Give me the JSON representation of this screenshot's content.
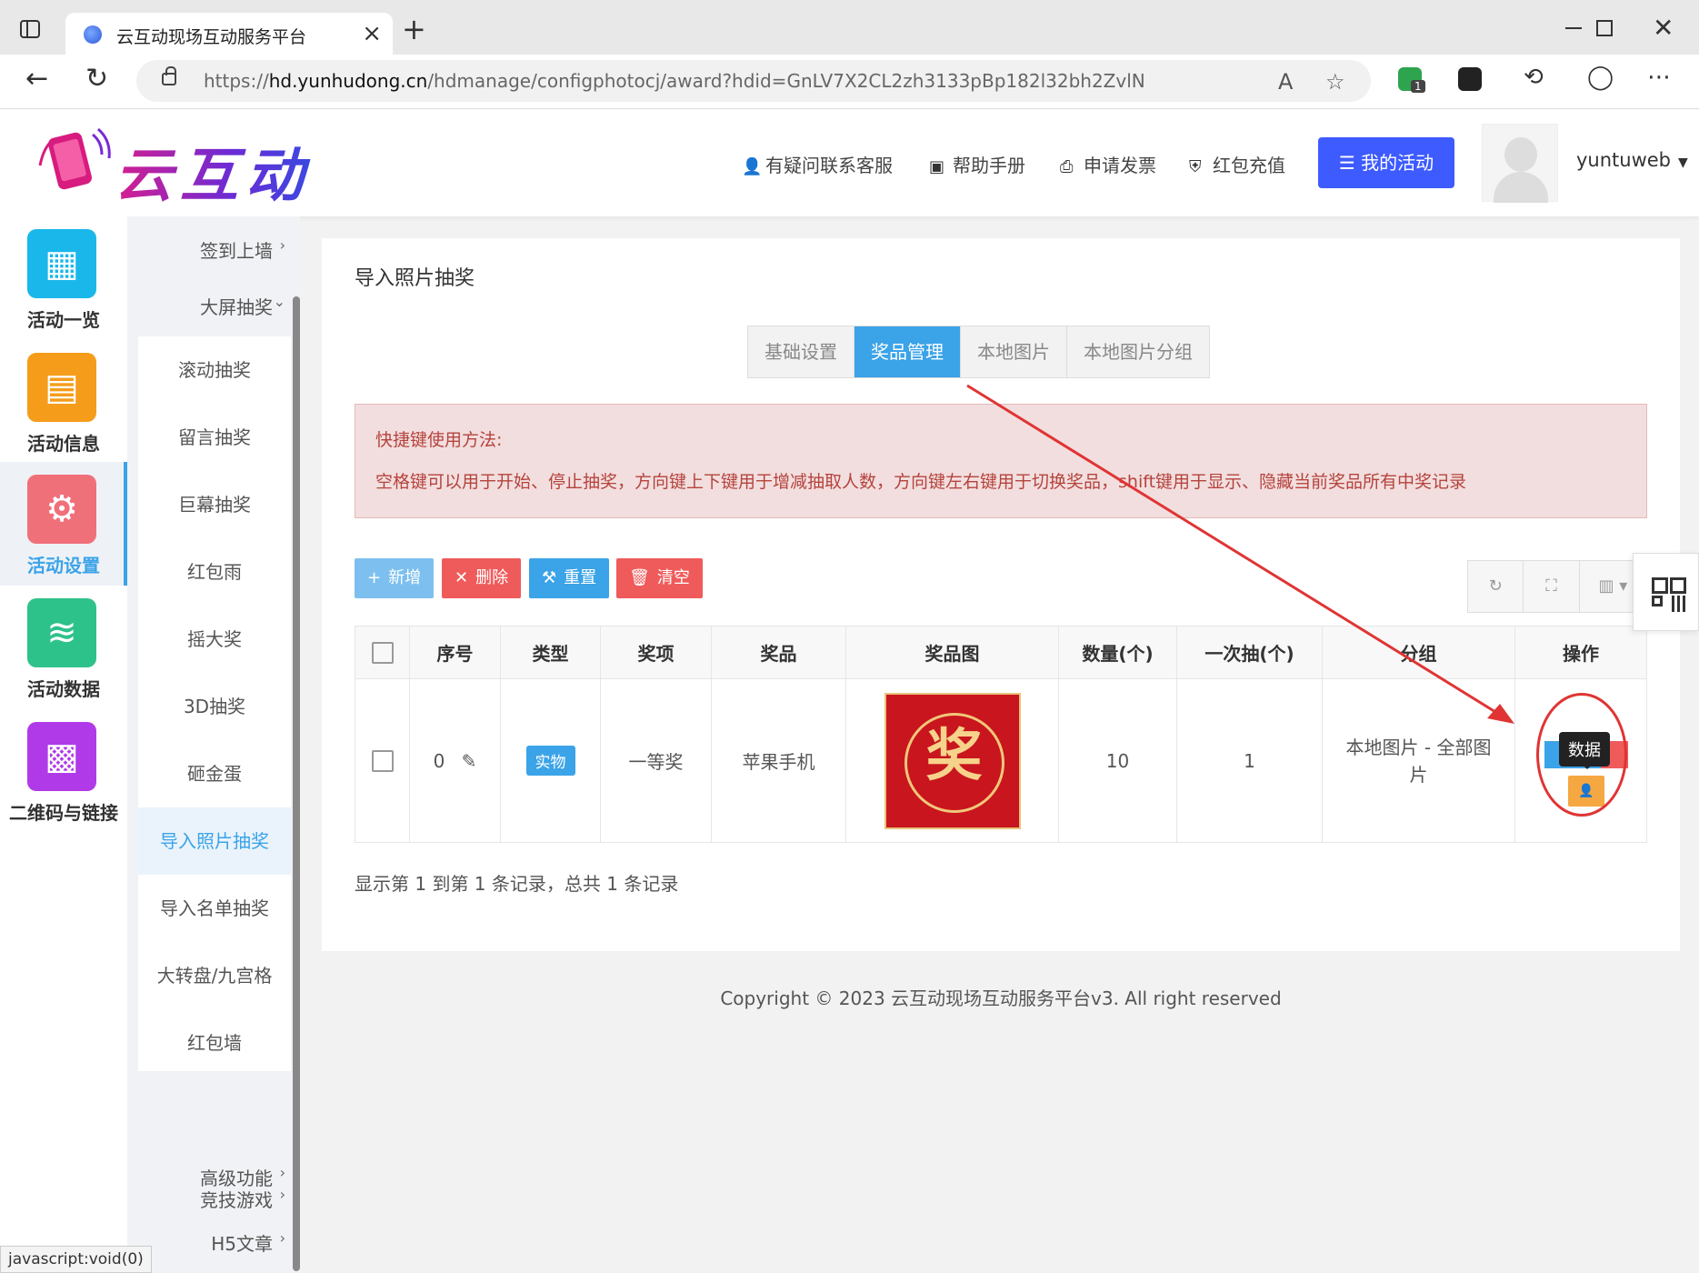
{
  "browser": {
    "tab_title": "云互动现场互动服务平台",
    "url_prefix": "https://",
    "url_host": "hd.yunhudong.cn",
    "url_path": "/hdmanage/configphotocj/award?hdid=GnLV7X2CL2zh3133pBp182l32bh2ZvlN",
    "extension_badge": "1",
    "status_text": "javascript:void(0)"
  },
  "header": {
    "logo_text": "云互动",
    "links": [
      {
        "icon": "add-user-icon",
        "label": "有疑问联系客服"
      },
      {
        "icon": "book-icon",
        "label": "帮助手册"
      },
      {
        "icon": "printer-icon",
        "label": "申请发票"
      },
      {
        "icon": "shield-check-icon",
        "label": "红包充值"
      }
    ],
    "my_activity": "我的活动",
    "username": "yuntuweb"
  },
  "sidebar": {
    "items": [
      {
        "label": "活动一览",
        "icon": "grid-icon",
        "color": "#1ab7ea"
      },
      {
        "label": "活动信息",
        "icon": "document-icon",
        "color": "#f59d1b"
      },
      {
        "label": "活动设置",
        "icon": "gear-icon",
        "color": "#f0707a"
      },
      {
        "label": "活动数据",
        "icon": "database-icon",
        "color": "#2ec28b"
      },
      {
        "label": "二维码与链接",
        "icon": "qrcode-icon",
        "color": "#b13ae8"
      }
    ]
  },
  "submenu": {
    "groups": [
      {
        "label": "签到上墙",
        "arrow": "›"
      },
      {
        "label": "大屏抽奖",
        "arrow": "⌄"
      }
    ],
    "items": [
      "滚动抽奖",
      "留言抽奖",
      "巨幕抽奖",
      "红包雨",
      "摇大奖",
      "3D抽奖",
      "砸金蛋",
      "导入照片抽奖",
      "导入名单抽奖",
      "大转盘/九宫格",
      "红包墙"
    ],
    "bottom_groups": [
      {
        "label": "竞技游戏",
        "arrow": "›"
      },
      {
        "label": "高级功能",
        "arrow": "›"
      },
      {
        "label": "H5文章",
        "arrow": "›"
      }
    ]
  },
  "content": {
    "title": "导入照片抽奖",
    "tabs": [
      "基础设置",
      "奖品管理",
      "本地图片",
      "本地图片分组"
    ],
    "notice_title": "快捷键使用方法:",
    "notice_body": "空格键可以用于开始、停止抽奖，方向键上下键用于增减抽取人数，方向键左右键用于切换奖品，shift键用于显示、隐藏当前奖品所有中奖记录",
    "buttons": {
      "add": "新增",
      "delete": "删除",
      "reset": "重置",
      "clear": "清空"
    },
    "table": {
      "headers": [
        "序号",
        "类型",
        "奖项",
        "奖品",
        "奖品图",
        "数量(个)",
        "一次抽(个)",
        "分组",
        "操作"
      ],
      "row": {
        "index": "0",
        "type": "实物",
        "level": "一等奖",
        "prize": "苹果手机",
        "image_char": "奖",
        "quantity": "10",
        "per_draw": "1",
        "group": "本地图片 - 全部图片",
        "tooltip": "数据"
      }
    },
    "pager": "显示第 1 到第 1 条记录，总共 1 条记录"
  },
  "footer": "Copyright © 2023 云互动现场互动服务平台v3. All right reserved"
}
